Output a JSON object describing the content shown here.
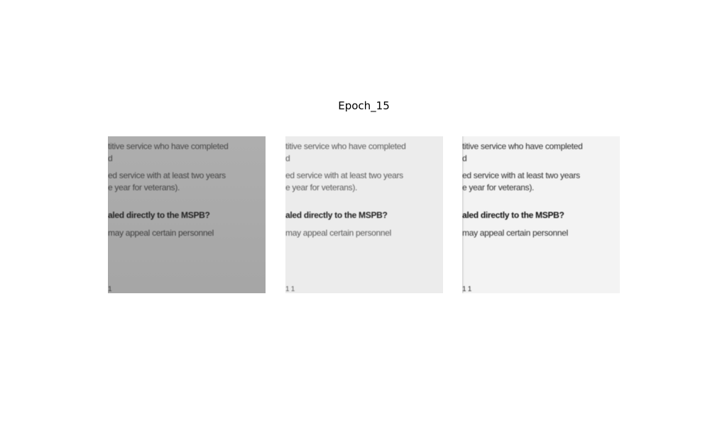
{
  "figure": {
    "title": "Epoch_15"
  },
  "panels": [
    {
      "lines": [
        "titive service who have completed",
        "d",
        "ed service with at least two years",
        "e year for veterans).",
        "aled directly to the MSPB?",
        "may appeal certain personnel",
        "  1"
      ]
    },
    {
      "lines": [
        "titive service who have completed",
        "d",
        "ed service with at least two years",
        "e year for veterans).",
        "aled directly to the MSPB?",
        "may appeal certain personnel",
        "  1 1"
      ]
    },
    {
      "lines": [
        "titive service who have completed",
        "d",
        "ed service with at least two years",
        "e year for veterans).",
        "aled directly to the MSPB?",
        "may appeal certain personnel",
        "  1 1"
      ]
    }
  ],
  "colors": {
    "background": "#ffffff",
    "panel_1_background": "#a9a9a9",
    "panel_2_background": "#ececec",
    "panel_3_background": "#f3f3f3"
  }
}
